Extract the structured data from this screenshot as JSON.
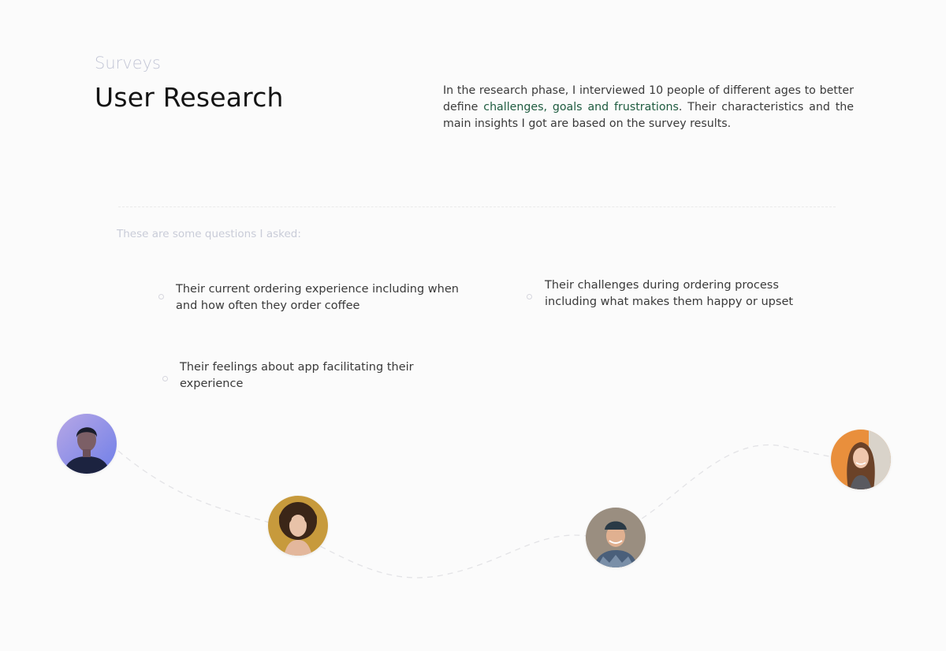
{
  "section": {
    "eyebrow": "Surveys",
    "title": "User Research"
  },
  "intro": {
    "before": "In the research phase, I interviewed 10 people of different ages to better define ",
    "highlight": "challenges, goals and frustrations",
    "after": ". Their characteristics and the main insights I got are based on the survey results.",
    "highlight_color": "#1f5c40"
  },
  "questions": {
    "label": "These are some questions I asked:",
    "items": [
      "Their current ordering experience including when and how often they order coffee",
      "Their challenges during ordering process including what makes them happy or upset",
      "Their feelings about app facilitating their experience"
    ]
  },
  "avatars": [
    {
      "icon": "person-portrait-blue-background"
    },
    {
      "icon": "person-portrait-curly-hair"
    },
    {
      "icon": "person-portrait-cap-smiling"
    },
    {
      "icon": "person-portrait-orange-background"
    }
  ]
}
